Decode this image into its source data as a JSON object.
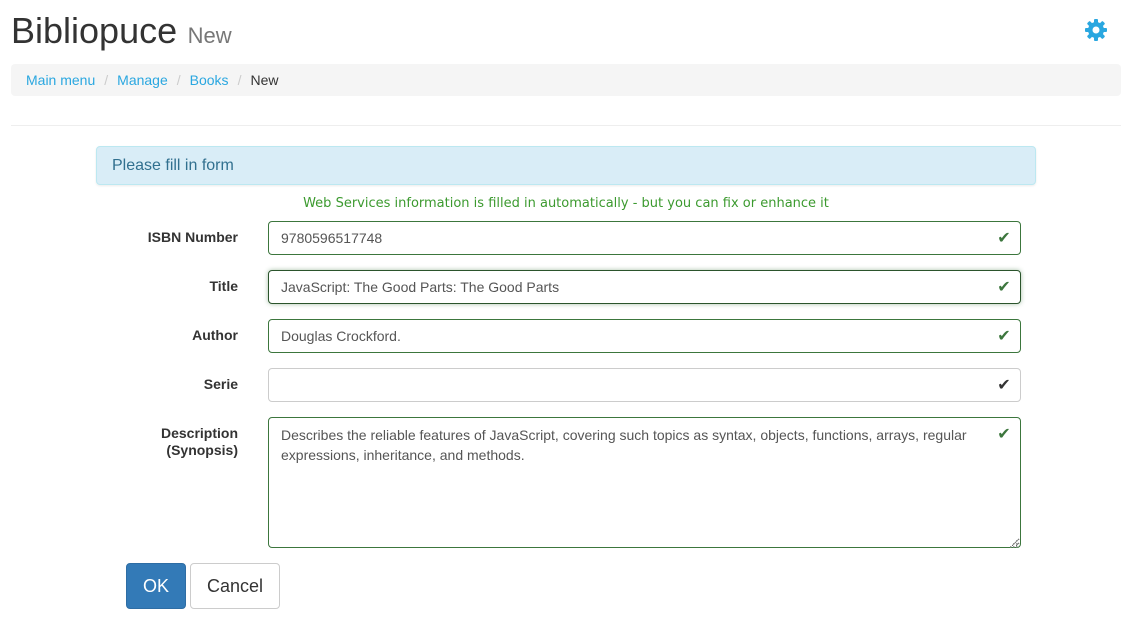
{
  "header": {
    "app_title": "Bibliopuce",
    "page_subtitle": "New",
    "settings_icon": "gear-icon",
    "accent_color": "#2aa7e0"
  },
  "breadcrumb": {
    "items": [
      "Main menu",
      "Manage",
      "Books"
    ],
    "separator": "/",
    "active": "New"
  },
  "form": {
    "notice": "Please fill in form",
    "hint": "Web Services information is filled in automatically - but you can fix or enhance it",
    "fields": {
      "isbn": {
        "label": "ISBN Number",
        "value": "9780596517748"
      },
      "title": {
        "label": "Title",
        "value": "JavaScript: The Good Parts: The Good Parts"
      },
      "author": {
        "label": "Author",
        "value": "Douglas Crockford."
      },
      "serie": {
        "label": "Serie",
        "value": ""
      },
      "description": {
        "label_line1": "Description",
        "label_line2": "(Synopsis)",
        "value": "Describes the reliable features of JavaScript, covering such topics as syntax, objects, functions, arrays, regular expressions, inheritance, and methods."
      }
    },
    "valid_color": "#3c763d",
    "check_glyph": "✔"
  },
  "buttons": {
    "ok": "OK",
    "cancel": "Cancel"
  }
}
